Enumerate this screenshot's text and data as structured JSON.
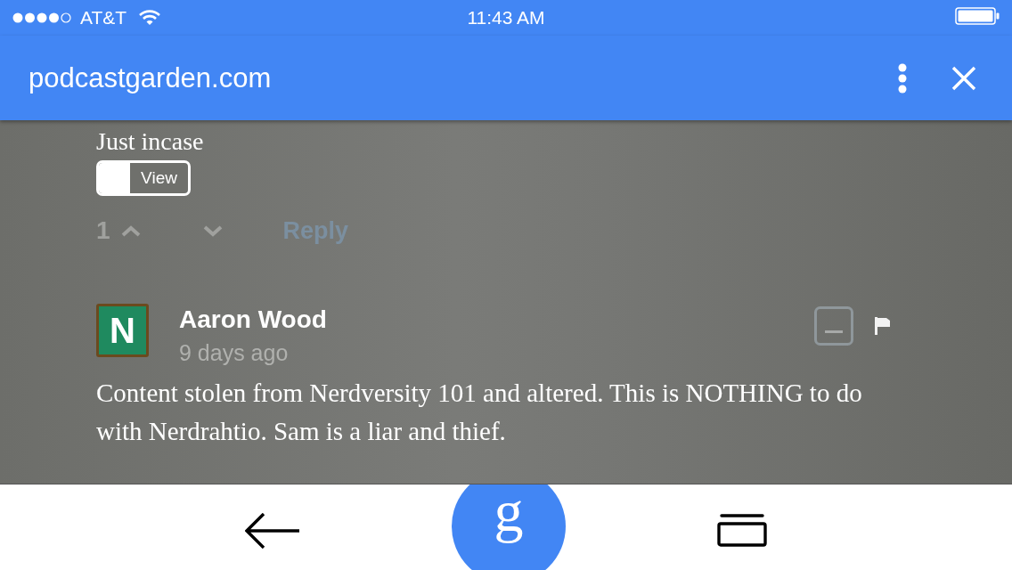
{
  "status_bar": {
    "carrier": "AT&T",
    "time": "11:43 AM"
  },
  "toolbar": {
    "title": "podcastgarden.com"
  },
  "comments": [
    {
      "kind": "reply-tail",
      "text": "Just incase",
      "toggle_label": "View",
      "votes": "1",
      "reply": "Reply"
    },
    {
      "kind": "comment",
      "author": "Aaron Wood",
      "time": "9 days ago",
      "avatar_letter": "N",
      "text": "Content stolen from Nerdversity 101 and altered. This is NOTHING to do with Nerdrahtio. Sam is a liar and thief."
    }
  ],
  "bottom_bar": {
    "assistant_label": "g"
  }
}
